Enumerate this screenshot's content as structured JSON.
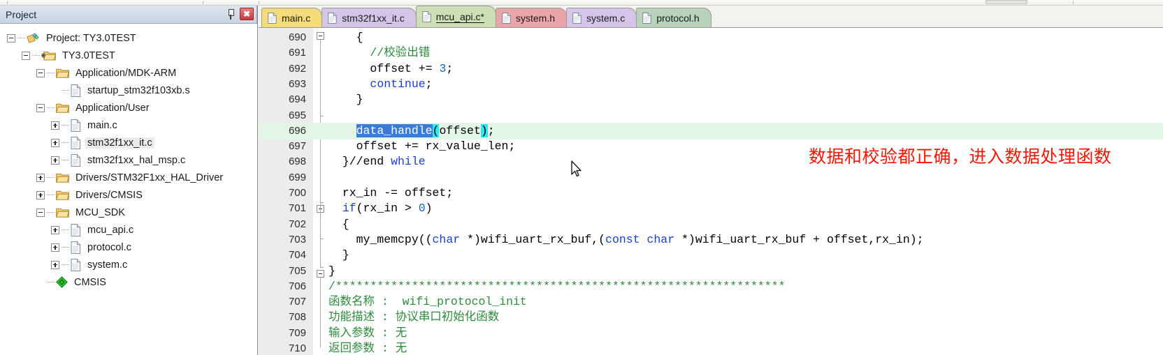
{
  "panel": {
    "title": "Project",
    "pin_icon": "pin-icon",
    "close_icon": "close-icon",
    "close_label": "✖",
    "tree": [
      {
        "depth": 0,
        "toggle": "minus",
        "icon": "project-icon",
        "label": "Project: TY3.0TEST",
        "selected": false
      },
      {
        "depth": 1,
        "toggle": "minus",
        "icon": "folder-target-icon",
        "label": "TY3.0TEST",
        "selected": false
      },
      {
        "depth": 2,
        "toggle": "minus",
        "icon": "folder-icon",
        "label": "Application/MDK-ARM",
        "selected": false
      },
      {
        "depth": 3,
        "toggle": "none",
        "icon": "file-icon",
        "label": "startup_stm32f103xb.s",
        "selected": false
      },
      {
        "depth": 2,
        "toggle": "minus",
        "icon": "folder-icon",
        "label": "Application/User",
        "selected": false
      },
      {
        "depth": 3,
        "toggle": "plus",
        "icon": "file-icon",
        "label": "main.c",
        "selected": false
      },
      {
        "depth": 3,
        "toggle": "plus",
        "icon": "file-icon",
        "label": "stm32f1xx_it.c",
        "selected": true
      },
      {
        "depth": 3,
        "toggle": "plus",
        "icon": "file-icon",
        "label": "stm32f1xx_hal_msp.c",
        "selected": false
      },
      {
        "depth": 2,
        "toggle": "plus",
        "icon": "folder-icon",
        "label": "Drivers/STM32F1xx_HAL_Driver",
        "selected": false
      },
      {
        "depth": 2,
        "toggle": "plus",
        "icon": "folder-icon",
        "label": "Drivers/CMSIS",
        "selected": false
      },
      {
        "depth": 2,
        "toggle": "minus",
        "icon": "folder-icon",
        "label": "MCU_SDK",
        "selected": false
      },
      {
        "depth": 3,
        "toggle": "plus",
        "icon": "file-icon",
        "label": "mcu_api.c",
        "selected": false
      },
      {
        "depth": 3,
        "toggle": "plus",
        "icon": "file-icon",
        "label": "protocol.c",
        "selected": false
      },
      {
        "depth": 3,
        "toggle": "plus",
        "icon": "file-icon",
        "label": "system.c",
        "selected": false
      },
      {
        "depth": 2,
        "toggle": "none",
        "icon": "cmsis-icon",
        "label": "CMSIS",
        "selected": false
      }
    ]
  },
  "editor": {
    "tabs": [
      {
        "label": "main.c",
        "color": "#f5db7a",
        "active": false
      },
      {
        "label": "stm32f1xx_it.c",
        "color": "#d5c5e8",
        "active": false
      },
      {
        "label": "mcu_api.c*",
        "color": "#cddfb4",
        "active": true
      },
      {
        "label": "system.h",
        "color": "#eaa5ab",
        "active": false
      },
      {
        "label": "system.c",
        "color": "#d5c5e8",
        "active": false
      },
      {
        "label": "protocol.h",
        "color": "#b8d2bc",
        "active": false
      }
    ],
    "annotation": "数据和校验都正确，进入数据处理函数",
    "annotation_color": "#fa1605",
    "first_line": 690,
    "highlight_line": 696,
    "lines": [
      {
        "n": 690,
        "text": "    {"
      },
      {
        "n": 691,
        "text": "      //校验出错"
      },
      {
        "n": 692,
        "text": "      offset += 3;"
      },
      {
        "n": 693,
        "text": "      continue;"
      },
      {
        "n": 694,
        "text": "    }"
      },
      {
        "n": 695,
        "text": ""
      },
      {
        "n": 696,
        "text": "    data_handle(offset);"
      },
      {
        "n": 697,
        "text": "    offset += rx_value_len;"
      },
      {
        "n": 698,
        "text": "  }//end while"
      },
      {
        "n": 699,
        "text": ""
      },
      {
        "n": 700,
        "text": "  rx_in -= offset;"
      },
      {
        "n": 701,
        "text": "  if(rx_in > 0)"
      },
      {
        "n": 702,
        "text": "  {"
      },
      {
        "n": 703,
        "text": "    my_memcpy((char *)wifi_uart_rx_buf,(const char *)wifi_uart_rx_buf + offset,rx_in);"
      },
      {
        "n": 704,
        "text": "  }"
      },
      {
        "n": 705,
        "text": "}"
      },
      {
        "n": 706,
        "text": "/*****************************************************************"
      },
      {
        "n": 707,
        "text": "函数名称 :  wifi_protocol_init"
      },
      {
        "n": 708,
        "text": "功能描述 : 协议串口初始化函数"
      },
      {
        "n": 709,
        "text": "输入参数 : 无"
      },
      {
        "n": 710,
        "text": "返回参数 : 无"
      }
    ]
  }
}
